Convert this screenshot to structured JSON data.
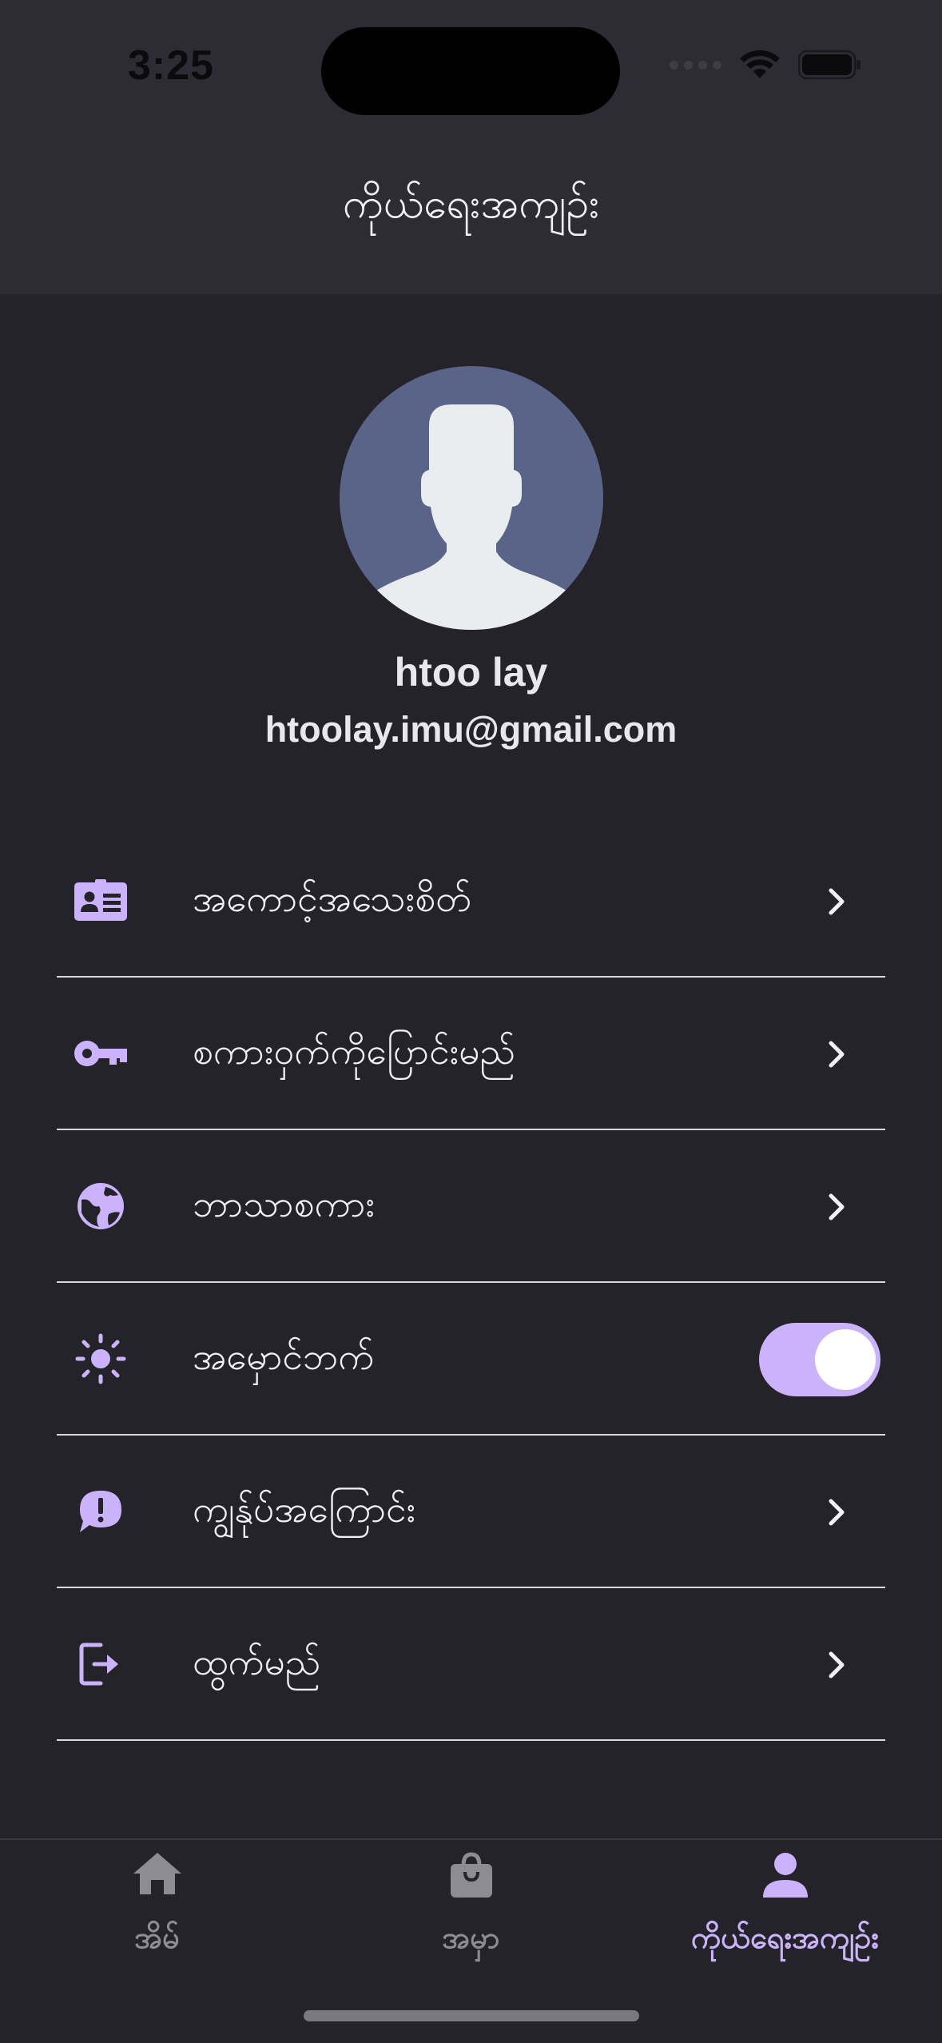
{
  "status_bar": {
    "time": "3:25",
    "wifi_icon": "wifi-icon",
    "battery_icon": "battery-icon"
  },
  "app_bar": {
    "title": "ကိုယ်ရေးအကျဉ်း"
  },
  "profile": {
    "avatar_icon": "default-avatar",
    "name": "htoo lay",
    "email": "htoolay.imu@gmail.com"
  },
  "menu": {
    "items": [
      {
        "label": "အကောင့်အသေးစိတ်",
        "icon": "id-card-icon",
        "trailing": "chevron"
      },
      {
        "label": "စကားဝှက်ကိုပြောင်းမည်",
        "icon": "key-icon",
        "trailing": "chevron"
      },
      {
        "label": "ဘာသာစကား",
        "icon": "globe-icon",
        "trailing": "chevron"
      },
      {
        "label": "အမှောင်ဘက်",
        "icon": "brightness-icon",
        "trailing": "toggle",
        "toggle_on": true
      },
      {
        "label": "ကျွန်ုပ်အကြောင်း",
        "icon": "feedback-icon",
        "trailing": "chevron"
      },
      {
        "label": "ထွက်မည်",
        "icon": "logout-icon",
        "trailing": "chevron"
      }
    ]
  },
  "bottom_nav": {
    "items": [
      {
        "label": "အိမ်",
        "icon": "home-icon",
        "active": false
      },
      {
        "label": "အမှာ",
        "icon": "shopping-bag-icon",
        "active": false
      },
      {
        "label": "ကိုယ်ရေးအကျဉ်း",
        "icon": "person-icon",
        "active": true
      }
    ]
  },
  "colors": {
    "background": "#24232a",
    "app_bar": "#2d2c34",
    "accent": "#cbb3fb",
    "avatar_bg": "#5a6488",
    "inactive_nav": "#8d8c94"
  }
}
